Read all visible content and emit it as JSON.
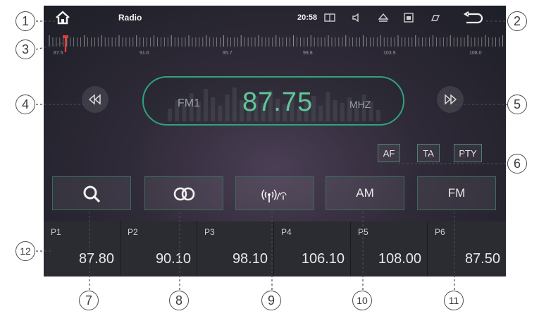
{
  "status_bar": {
    "title": "Radio",
    "clock": "20:58",
    "icons": [
      "home-icon",
      "window-icon",
      "speaker-icon",
      "eject-icon",
      "picture-icon",
      "minimize-icon",
      "back-icon"
    ]
  },
  "ruler": {
    "labels": [
      "87.5",
      "91.6",
      "95.7",
      "99.8",
      "103.9",
      "108.0"
    ]
  },
  "display": {
    "band": "FM1",
    "frequency": "87.75",
    "unit": "MHZ"
  },
  "options": {
    "af": "AF",
    "ta": "TA",
    "pty": "PTY"
  },
  "functions": {
    "am": "AM",
    "fm": "FM"
  },
  "presets": [
    {
      "name": "P1",
      "freq": "87.80"
    },
    {
      "name": "P2",
      "freq": "90.10"
    },
    {
      "name": "P3",
      "freq": "98.10"
    },
    {
      "name": "P4",
      "freq": "106.10"
    },
    {
      "name": "P5",
      "freq": "108.00"
    },
    {
      "name": "P6",
      "freq": "87.50"
    }
  ],
  "callouts": [
    "1",
    "2",
    "3",
    "4",
    "5",
    "6",
    "7",
    "8",
    "9",
    "10",
    "11",
    "12"
  ],
  "colors": {
    "accent": "#5fc79a",
    "tuner_marker": "#e23b3b",
    "frame": "#2fa37a"
  }
}
